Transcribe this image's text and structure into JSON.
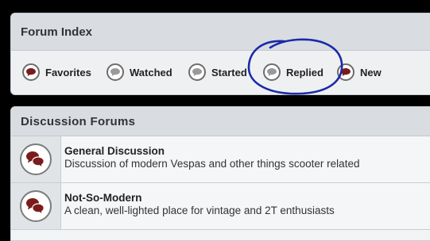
{
  "forum_index": {
    "title": "Forum Index",
    "tabs": [
      {
        "label": "Favorites",
        "icon": "speech-bubble-red-icon",
        "active": true
      },
      {
        "label": "Watched",
        "icon": "speech-bubble-gray-icon",
        "active": false
      },
      {
        "label": "Started",
        "icon": "speech-bubble-gray-icon",
        "active": false
      },
      {
        "label": "Replied",
        "icon": "speech-bubble-gray-icon",
        "active": false
      },
      {
        "label": "New",
        "icon": "speech-bubble-red-icon",
        "active": true
      }
    ]
  },
  "discussion_forums": {
    "title": "Discussion Forums",
    "rows": [
      {
        "title": "General Discussion",
        "description": "Discussion of modern Vespas and other things scooter related",
        "icon": "double-speech-bubble-red-icon"
      },
      {
        "title": "Not-So-Modern",
        "description": "A clean, well-lighted place for vintage and 2T enthusiasts",
        "icon": "double-speech-bubble-red-icon"
      }
    ]
  },
  "colors": {
    "active_bubble": "#7a1c1c",
    "inactive_bubble": "#9a9a9a",
    "annotation_ink": "#1a2aa8",
    "header_bg": "#d9dde2"
  }
}
